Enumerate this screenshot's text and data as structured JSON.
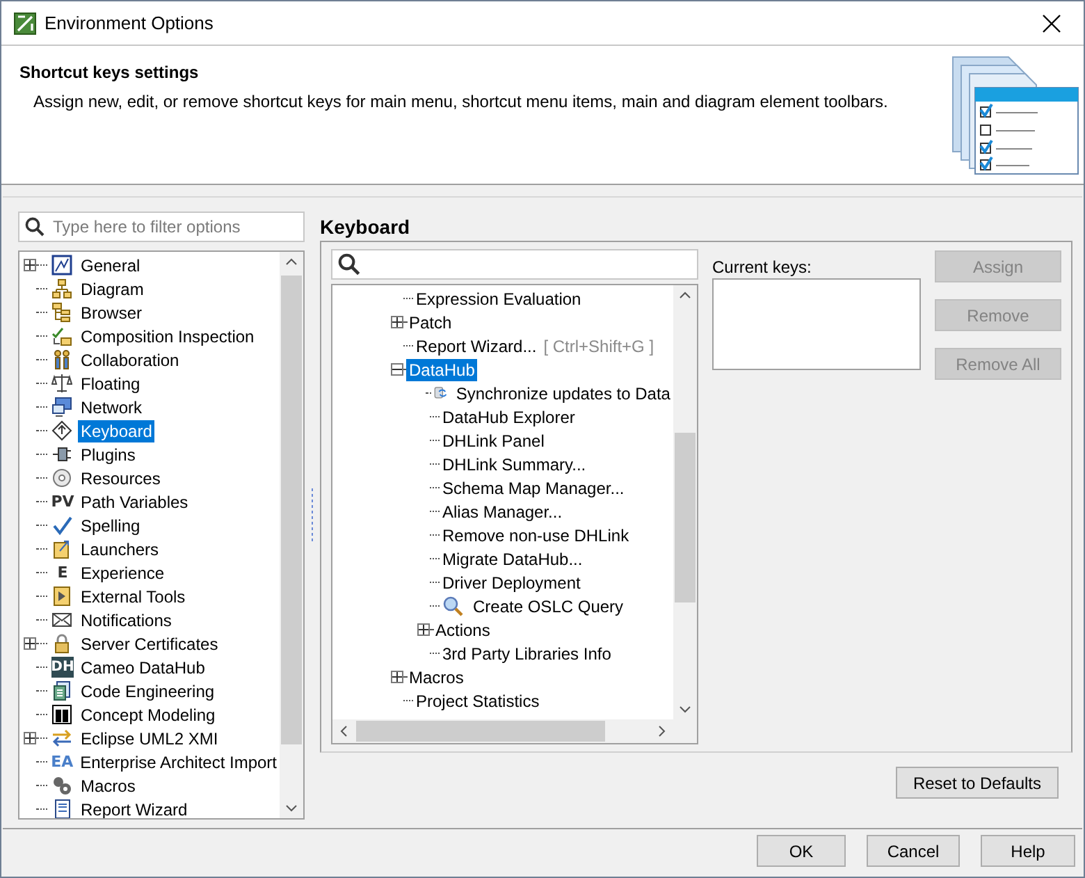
{
  "window": {
    "title": "Environment Options"
  },
  "header": {
    "title": "Shortcut keys settings",
    "description": "Assign new, edit, or remove shortcut keys for main menu, shortcut menu items, main and diagram element toolbars."
  },
  "filter": {
    "placeholder": "Type here to filter options"
  },
  "options_tree": [
    {
      "label": "General",
      "expandable": true,
      "expanded": false,
      "selected": false
    },
    {
      "label": "Diagram",
      "expandable": false,
      "selected": false
    },
    {
      "label": "Browser",
      "expandable": false,
      "selected": false
    },
    {
      "label": "Composition Inspection",
      "expandable": false,
      "selected": false
    },
    {
      "label": "Collaboration",
      "expandable": false,
      "selected": false
    },
    {
      "label": "Floating",
      "expandable": false,
      "selected": false
    },
    {
      "label": "Network",
      "expandable": false,
      "selected": false
    },
    {
      "label": "Keyboard",
      "expandable": false,
      "selected": true
    },
    {
      "label": "Plugins",
      "expandable": false,
      "selected": false
    },
    {
      "label": "Resources",
      "expandable": false,
      "selected": false
    },
    {
      "label": "Path Variables",
      "expandable": false,
      "selected": false,
      "badge": "PV",
      "kind": "plain"
    },
    {
      "label": "Spelling",
      "expandable": false,
      "selected": false
    },
    {
      "label": "Launchers",
      "expandable": false,
      "selected": false
    },
    {
      "label": "Experience",
      "expandable": false,
      "selected": false,
      "badge": "E",
      "kind": "plain"
    },
    {
      "label": "External Tools",
      "expandable": false,
      "selected": false
    },
    {
      "label": "Notifications",
      "expandable": false,
      "selected": false
    },
    {
      "label": "Server Certificates",
      "expandable": true,
      "expanded": false,
      "selected": false
    },
    {
      "label": "Cameo DataHub",
      "expandable": false,
      "selected": false,
      "badge": "DH",
      "kind": "tile"
    },
    {
      "label": "Code Engineering",
      "expandable": false,
      "selected": false
    },
    {
      "label": "Concept Modeling",
      "expandable": false,
      "selected": false
    },
    {
      "label": "Eclipse UML2 XMI",
      "expandable": true,
      "expanded": false,
      "selected": false
    },
    {
      "label": "Enterprise Architect Import",
      "expandable": false,
      "selected": false,
      "badge": "EA",
      "kind": "accent"
    },
    {
      "label": "Macros",
      "expandable": false,
      "selected": false
    },
    {
      "label": "Report Wizard",
      "expandable": false,
      "selected": false
    }
  ],
  "keyboard": {
    "title": "Keyboard",
    "tree": [
      {
        "label": "Expression Evaluation",
        "expandable": false,
        "selected": false
      },
      {
        "label": "Patch",
        "expandable": true,
        "expanded": false,
        "selected": false
      },
      {
        "label": "Report Wizard...",
        "shortcut": "[ Ctrl+Shift+G ]",
        "expandable": false,
        "selected": false
      },
      {
        "label": "DataHub",
        "expandable": true,
        "expanded": true,
        "selected": true,
        "children": [
          {
            "label": "Synchronize updates to Data",
            "expandable": false,
            "selected": false,
            "kind": "sync"
          },
          {
            "label": "DataHub Explorer",
            "expandable": false,
            "selected": false
          },
          {
            "label": "DHLink Panel",
            "expandable": false,
            "selected": false
          },
          {
            "label": "DHLink Summary...",
            "expandable": false,
            "selected": false
          },
          {
            "label": "Schema Map Manager...",
            "expandable": false,
            "selected": false
          },
          {
            "label": "Alias Manager...",
            "expandable": false,
            "selected": false
          },
          {
            "label": "Remove non-use DHLink",
            "expandable": false,
            "selected": false
          },
          {
            "label": "Migrate DataHub...",
            "expandable": false,
            "selected": false
          },
          {
            "label": "Driver Deployment",
            "expandable": false,
            "selected": false
          },
          {
            "label": "Create OSLC Query",
            "expandable": false,
            "selected": false,
            "kind": "search"
          },
          {
            "label": "Actions",
            "expandable": true,
            "expanded": false,
            "selected": false
          },
          {
            "label": "3rd Party Libraries Info",
            "expandable": false,
            "selected": false
          }
        ]
      },
      {
        "label": "Macros",
        "expandable": true,
        "expanded": false,
        "selected": false
      },
      {
        "label": "Project Statistics",
        "expandable": false,
        "selected": false
      }
    ],
    "current_keys_label": "Current keys:",
    "buttons": [
      {
        "label": "Assign",
        "disabled": true
      },
      {
        "label": "Remove",
        "disabled": true
      },
      {
        "label": "Remove All",
        "disabled": true
      }
    ],
    "reset": "Reset to Defaults"
  },
  "footer_buttons": [
    "OK",
    "Cancel",
    "Help"
  ]
}
